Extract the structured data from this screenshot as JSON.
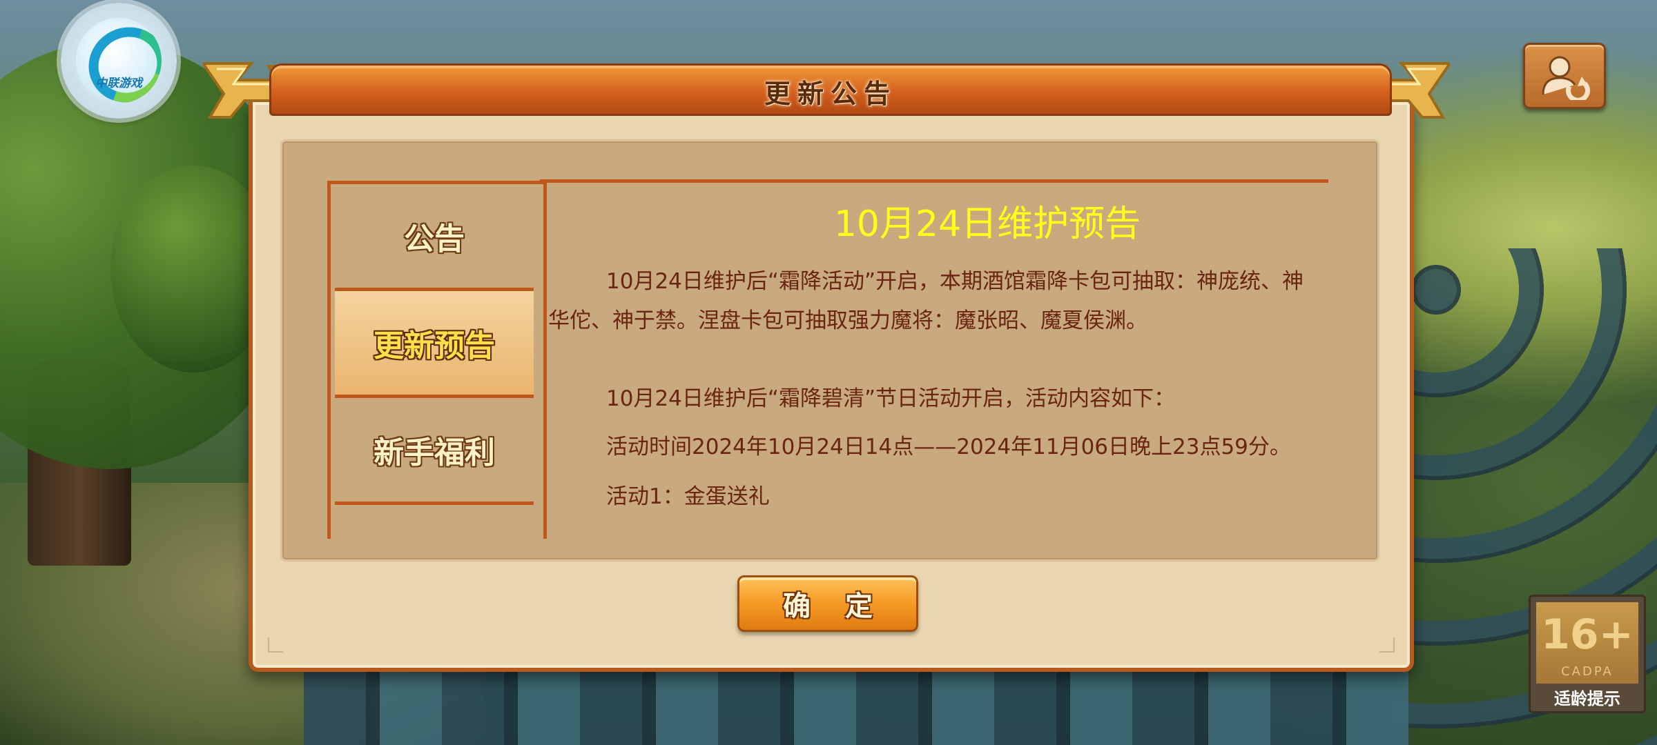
{
  "logo": {
    "text": "中联游戏"
  },
  "dialog": {
    "title": "更新公告",
    "tabs": [
      {
        "label": "公告",
        "active": false
      },
      {
        "label": "更新预告",
        "active": true
      },
      {
        "label": "新手福利",
        "active": false
      }
    ],
    "content": {
      "title": "10月24日维护预告",
      "para1": "10月24日维护后“霜降活动”开启，本期酒馆霜降卡包可抽取：神庞统、神华佗、神于禁。涅盘卡包可抽取强力魔将：魔张昭、魔夏侯渊。",
      "para2": "10月24日维护后“霜降碧清”节日活动开启，活动内容如下：",
      "para3": "活动时间2024年10月24日14点——2024年11月06日晚上23点59分。",
      "para4": "活动1：金蛋送礼"
    },
    "confirm_label": "确 定"
  },
  "age_badge": {
    "rating": "16+",
    "org": "CADPA",
    "label": "适龄提示"
  },
  "icons": {
    "switch_account": "switch-account-icon"
  },
  "colors": {
    "title_bar": "#d4601d",
    "content_title": "#ffff1a",
    "body_text": "#6a2412",
    "active_tab_text": "#ffe04a"
  }
}
